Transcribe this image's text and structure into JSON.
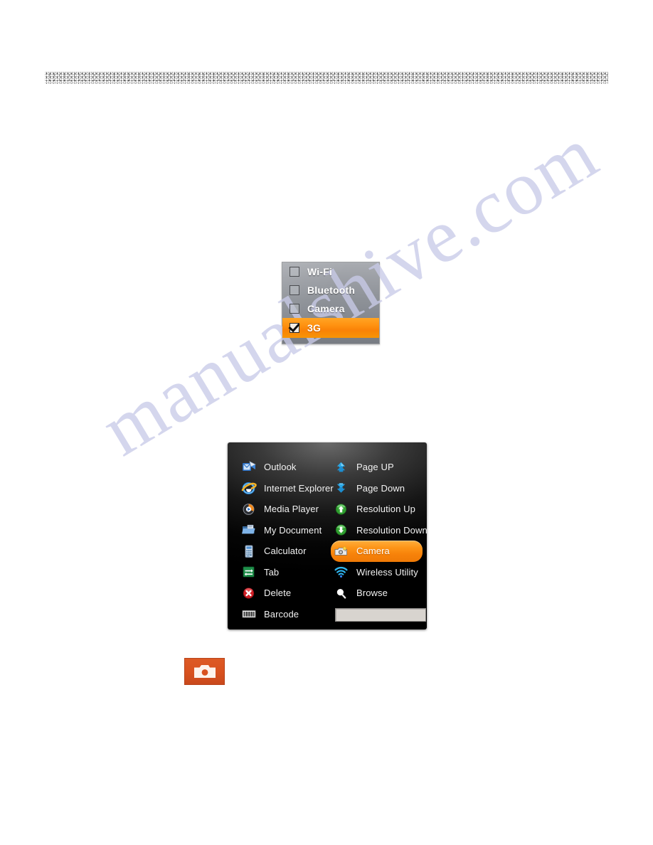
{
  "page": {
    "background_color": "#ffffff",
    "redacted_bar": {
      "present": true,
      "color": "#3a3a3a"
    },
    "watermark": {
      "text": "manualshive.com",
      "color": "#c9cbe8"
    }
  },
  "toggle_panel": {
    "name": "radio-toggle-panel",
    "accent_color": "#ff9110",
    "rows": [
      {
        "label": "Wi-Fi",
        "checked": false
      },
      {
        "label": "Bluetooth",
        "checked": false
      },
      {
        "label": "Camera",
        "checked": false
      },
      {
        "label": "3G",
        "checked": true
      }
    ]
  },
  "launcher_panel": {
    "name": "quick-launch-menu",
    "highlight_color": "#f7820a",
    "left_column": [
      {
        "label": "Outlook",
        "icon": "outlook-icon"
      },
      {
        "label": "Internet Explorer",
        "icon": "internet-explorer-icon"
      },
      {
        "label": "Media Player",
        "icon": "media-player-icon"
      },
      {
        "label": "My Document",
        "icon": "my-document-icon"
      },
      {
        "label": "Calculator",
        "icon": "calculator-icon"
      },
      {
        "label": "Tab",
        "icon": "tab-icon"
      },
      {
        "label": "Delete",
        "icon": "delete-icon"
      },
      {
        "label": "Barcode",
        "icon": "barcode-icon"
      }
    ],
    "right_column": [
      {
        "label": "Page UP",
        "icon": "page-up-icon",
        "highlight": false
      },
      {
        "label": "Page Down",
        "icon": "page-down-icon",
        "highlight": false
      },
      {
        "label": "Resolution Up",
        "icon": "resolution-up-icon",
        "highlight": false
      },
      {
        "label": "Resolution Down",
        "icon": "resolution-down-icon",
        "highlight": false
      },
      {
        "label": "Camera",
        "icon": "camera-icon",
        "highlight": true
      },
      {
        "label": "Wireless Utility",
        "icon": "wireless-utility-icon",
        "highlight": false
      },
      {
        "label": "Browse",
        "icon": "browse-magnifier-icon",
        "highlight": false
      }
    ],
    "text_field": {
      "value": "",
      "placeholder": ""
    }
  },
  "camera_button": {
    "name": "camera-toolbar-button",
    "icon": "camera-icon",
    "background_color": "#d9521f"
  }
}
